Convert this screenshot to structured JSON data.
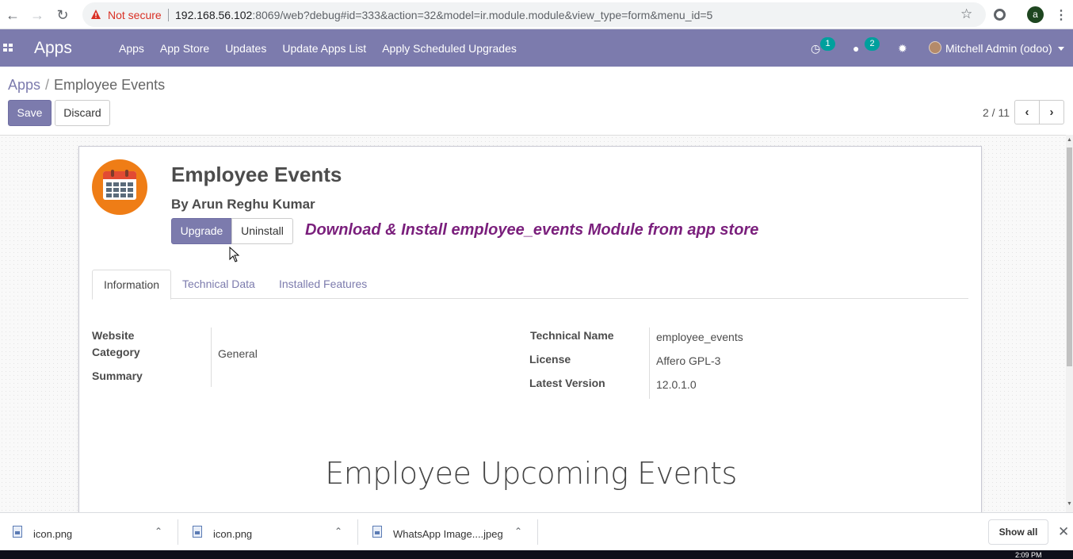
{
  "browser": {
    "not_secure": "Not secure",
    "url_host": "192.168.56.102",
    "url_rest": ":8069/web?debug#id=333&action=32&model=ir.module.module&view_type=form&menu_id=5",
    "profile_initial": "a"
  },
  "topbar": {
    "app_title": "Apps",
    "menu": [
      "Apps",
      "App Store",
      "Updates",
      "Update Apps List",
      "Apply Scheduled Upgrades"
    ],
    "activity_count": "1",
    "messages_count": "2",
    "user_name": "Mitchell Admin (odoo)"
  },
  "breadcrumb": {
    "parent": "Apps",
    "separator": "/",
    "current": "Employee Events"
  },
  "buttons": {
    "save": "Save",
    "discard": "Discard"
  },
  "pager": {
    "value": "2 / 11"
  },
  "module": {
    "name": "Employee Events",
    "author": "By Arun Reghu Kumar",
    "upgrade_label": "Upgrade",
    "uninstall_label": "Uninstall",
    "annotation": "Download & Install employee_events Module from app store"
  },
  "tabs": [
    "Information",
    "Technical Data",
    "Installed Features"
  ],
  "info": {
    "website_label": "Website",
    "category_label": "Category",
    "category_value": "General",
    "summary_label": "Summary",
    "technical_name_label": "Technical Name",
    "technical_name_value": "employee_events",
    "license_label": "License",
    "license_value": "Affero GPL-3",
    "latest_version_label": "Latest Version",
    "latest_version_value": "12.0.1.0"
  },
  "description": {
    "title": "Employee Upcoming Events"
  },
  "downloads": {
    "items": [
      "icon.png",
      "icon.png",
      "WhatsApp Image....jpeg"
    ],
    "show_all": "Show all"
  },
  "taskbar": {
    "clock": "2:09 PM"
  }
}
